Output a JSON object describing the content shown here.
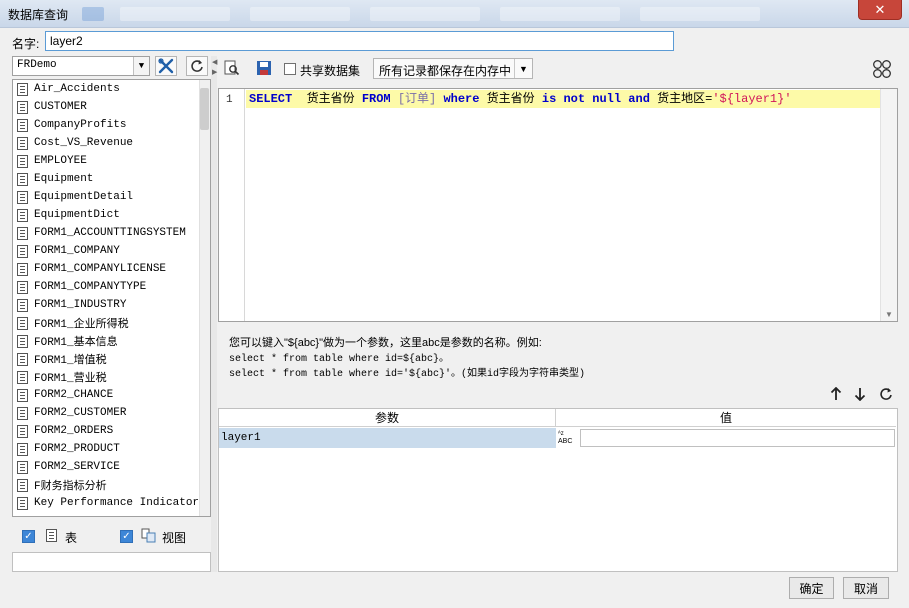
{
  "window": {
    "title": "数据库查询",
    "close_glyph": "✕"
  },
  "name_row": {
    "label": "名字:",
    "value": "layer2"
  },
  "datasource": {
    "selected": "FRDemo"
  },
  "tables": [
    "Air_Accidents",
    "CUSTOMER",
    "CompanyProfits",
    "Cost_VS_Revenue",
    "EMPLOYEE",
    "Equipment",
    "EquipmentDetail",
    "EquipmentDict",
    "FORM1_ACCOUNTTINGSYSTEM",
    "FORM1_COMPANY",
    "FORM1_COMPANYLICENSE",
    "FORM1_COMPANYTYPE",
    "FORM1_INDUSTRY",
    "FORM1_企业所得税",
    "FORM1_基本信息",
    "FORM1_增值税",
    "FORM1_营业税",
    "FORM2_CHANCE",
    "FORM2_CUSTOMER",
    "FORM2_ORDERS",
    "FORM2_PRODUCT",
    "FORM2_SERVICE",
    "F财务指标分析",
    "Key Performance Indicators"
  ],
  "filters": {
    "table_label": "表",
    "view_label": "视图"
  },
  "toolbar": {
    "share_label": "共享数据集",
    "memory_option": "所有记录都保存在内存中"
  },
  "editor": {
    "line_number": "1",
    "tokens": [
      {
        "t": "SELECT",
        "c": "kw"
      },
      {
        "t": "  货主省份 ",
        "c": "id"
      },
      {
        "t": "FROM",
        "c": "kw"
      },
      {
        "t": " [订单] ",
        "c": "tb"
      },
      {
        "t": "where",
        "c": "kw"
      },
      {
        "t": " 货主省份 ",
        "c": "id"
      },
      {
        "t": "is not null",
        "c": "kw"
      },
      {
        "t": " ",
        "c": "id"
      },
      {
        "t": "and",
        "c": "kw"
      },
      {
        "t": " 货主地区=",
        "c": "id"
      },
      {
        "t": "'${layer1}'",
        "c": "str"
      }
    ]
  },
  "hint": {
    "line1": "您可以键入\"${abc}\"做为一个参数，这里abc是参数的名称。例如:",
    "line2": "select * from table where id=${abc}。",
    "line3": "select * from table where id='${abc}'。(如果id字段为字符串类型)"
  },
  "params": {
    "col_param": "参数",
    "col_value": "值",
    "rows": [
      {
        "name": "layer1",
        "type_icon": "ABC",
        "value": ""
      }
    ]
  },
  "footer": {
    "ok": "确定",
    "cancel": "取消"
  }
}
